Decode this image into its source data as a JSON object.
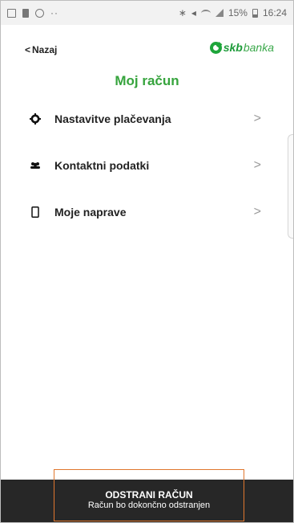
{
  "status_bar": {
    "dots": "··",
    "battery_percent": "15%",
    "time": "16:24",
    "icons": [
      "gallery-icon",
      "trash-icon",
      "target-icon",
      "bluetooth-icon",
      "mute-icon",
      "wifi-icon",
      "signal-icon",
      "battery-icon"
    ]
  },
  "header": {
    "back_label": "Nazaj",
    "logo_skb": "skb",
    "logo_banka": "banka"
  },
  "page_title": "Moj račun",
  "menu": {
    "items": [
      {
        "label": "Nastavitve plačevanja",
        "icon": "gear-icon"
      },
      {
        "label": "Kontaktni podatki",
        "icon": "people-icon"
      },
      {
        "label": "Moje naprave",
        "icon": "phone-icon"
      }
    ]
  },
  "bottom": {
    "title": "ODSTRANI RAČUN",
    "subtitle": "Račun bo dokončno odstranjen"
  },
  "colors": {
    "accent_green": "#36a43d",
    "bottom_bar": "#272727",
    "highlight_border": "#e0772e"
  }
}
